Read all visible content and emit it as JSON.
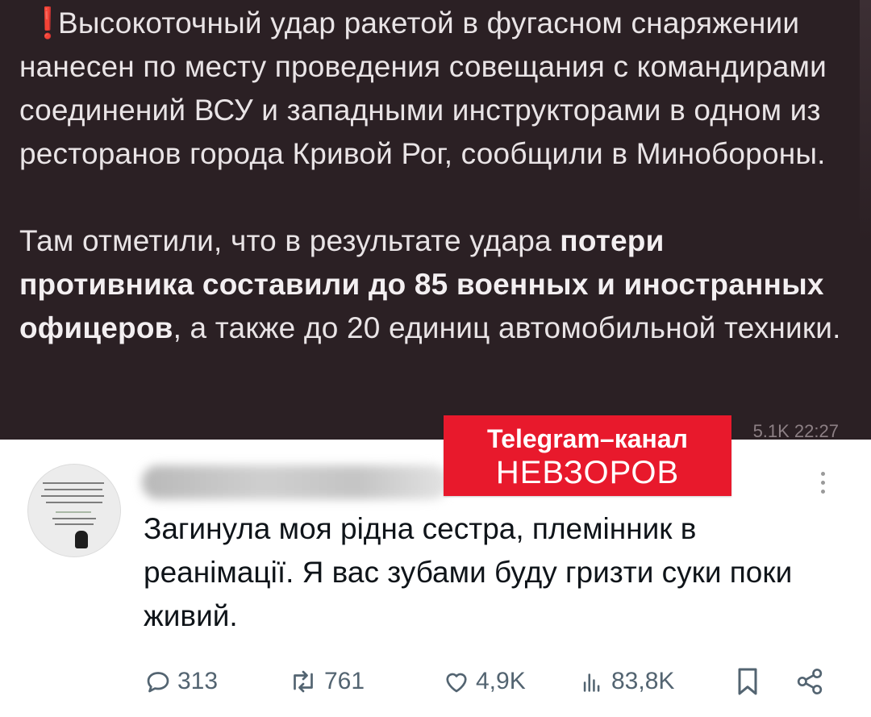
{
  "telegram_post": {
    "marker": "❗",
    "paragraph1": "Высокоточный удар ракетой в фугасном снаряжении нанесен по месту проведения совещания с командирами соединений ВСУ и западными инструкторами в одном из ресторанов города Кривой Рог, сообщили в Минобороны.",
    "paragraph2_pre": "Там отметили, что в результате удара ",
    "paragraph2_bold": "потери противника составили до 85 военных и иностранных офицеров",
    "paragraph2_post": ", а также до 20 единиц автомобильной техники.",
    "meta": "5.1K 22:27"
  },
  "badge": {
    "line1": "Telegram–канал",
    "line2": "НЕВЗОРОВ"
  },
  "reply": {
    "text": "Загинула моя рідна сестра, племінник в реанімації. Я вас зубами буду гризти суки поки живий.",
    "actions": {
      "replies": "313",
      "reposts": "761",
      "likes": "4,9K",
      "views": "83,8K"
    }
  },
  "colors": {
    "dark_bg": "#2b2024",
    "badge_red": "#e8192c",
    "action_gray": "#536471"
  }
}
